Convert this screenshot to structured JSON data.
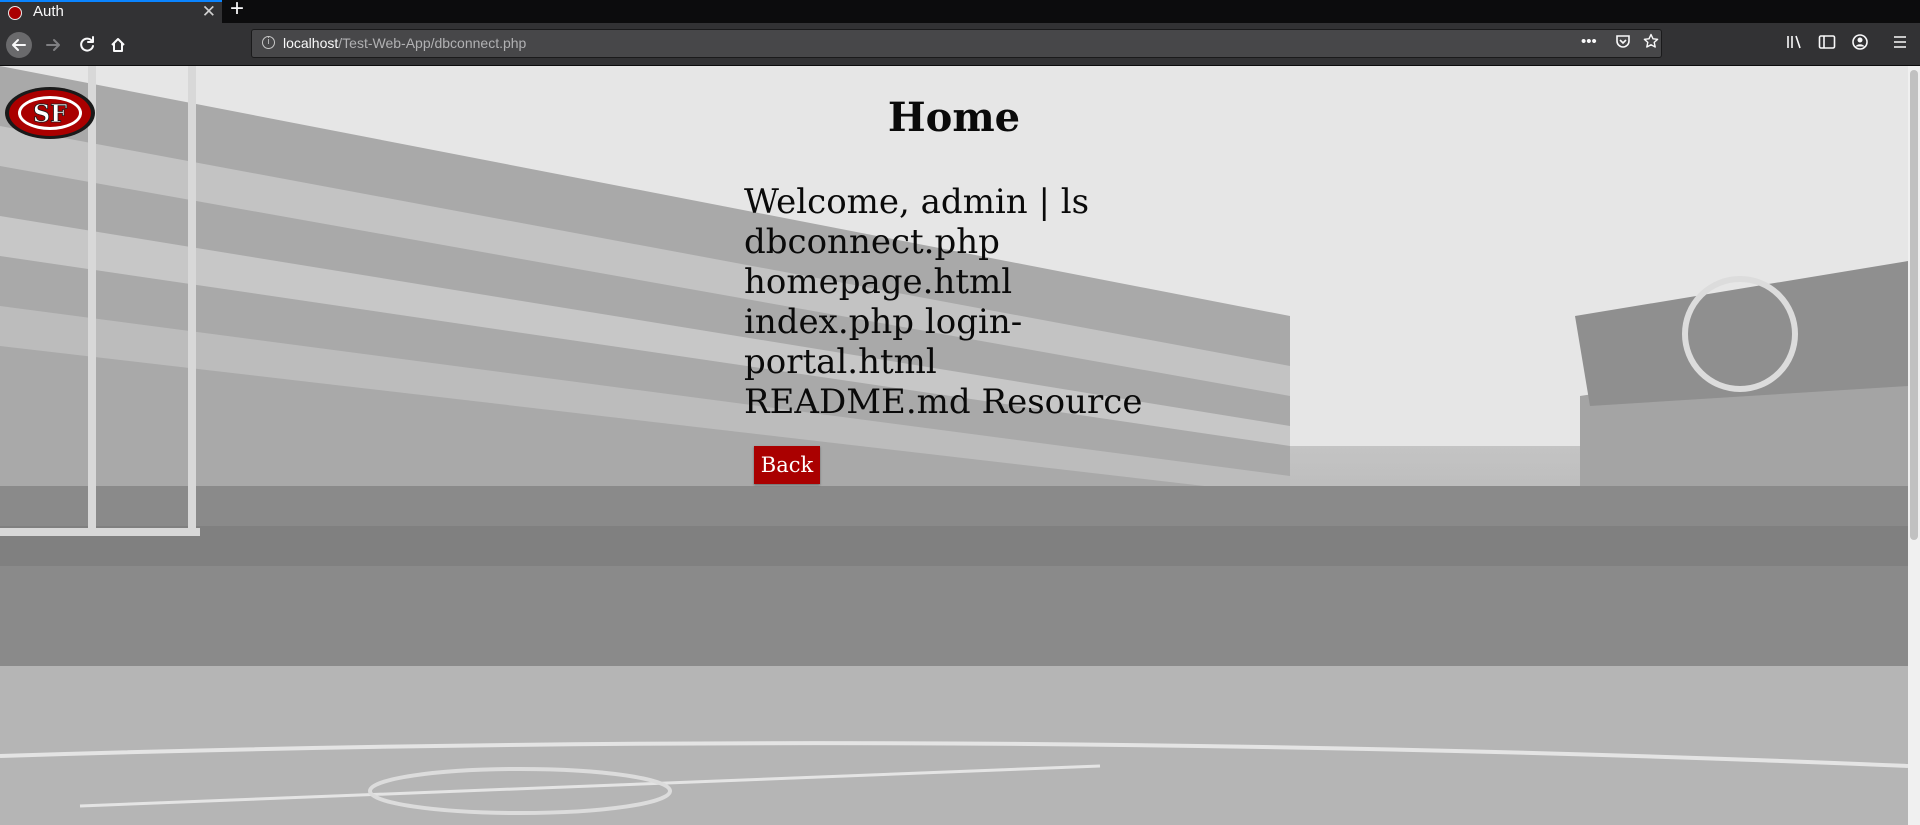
{
  "browser": {
    "tab": {
      "title": "Auth",
      "close": "✕"
    },
    "new_tab": "+",
    "url": {
      "host": "localhost",
      "path": "/Test-Web-App/dbconnect.php"
    },
    "url_actions": [
      "•••",
      "pocket",
      "star"
    ],
    "toolbar_icons": [
      "library-icon",
      "sidebar-icon",
      "account-icon",
      "menu-icon"
    ]
  },
  "page": {
    "title": "Home",
    "output": "Welcome, admin | ls dbconnect.php homepage.html index.php login-portal.html README.md Resource",
    "back_label": "Back"
  },
  "colors": {
    "accent": "#aa0000",
    "chrome_dark": "#0c0c0d",
    "chrome": "#323234"
  }
}
